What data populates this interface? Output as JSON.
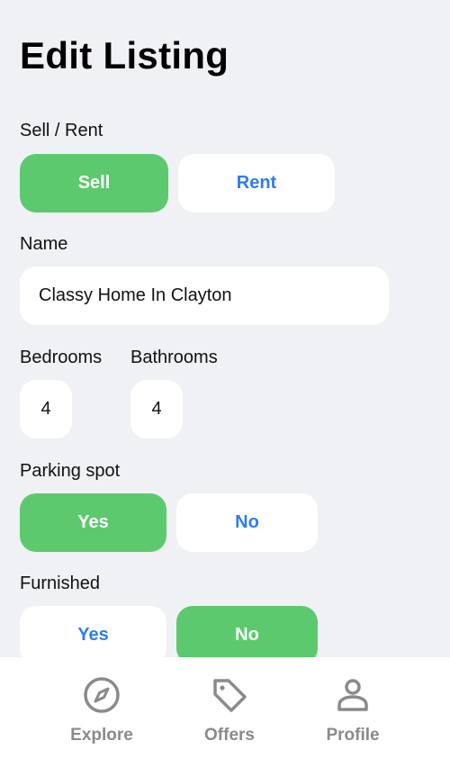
{
  "page_title": "Edit Listing",
  "sell_rent": {
    "label": "Sell / Rent",
    "options": [
      "Sell",
      "Rent"
    ],
    "selected": "Sell"
  },
  "name": {
    "label": "Name",
    "value": "Classy Home In Clayton"
  },
  "bedrooms": {
    "label": "Bedrooms",
    "value": "4"
  },
  "bathrooms": {
    "label": "Bathrooms",
    "value": "4"
  },
  "parking": {
    "label": "Parking spot",
    "options": [
      "Yes",
      "No"
    ],
    "selected": "Yes"
  },
  "furnished": {
    "label": "Furnished",
    "options": [
      "Yes",
      "No"
    ],
    "selected": "No"
  },
  "tabbar": {
    "items": [
      {
        "label": "Explore",
        "icon": "compass-icon"
      },
      {
        "label": "Offers",
        "icon": "tag-icon"
      },
      {
        "label": "Profile",
        "icon": "person-icon"
      }
    ]
  },
  "colors": {
    "selected_bg": "#5dc96e",
    "unselected_text": "#2f7cf0",
    "background": "#f0f1f5"
  }
}
